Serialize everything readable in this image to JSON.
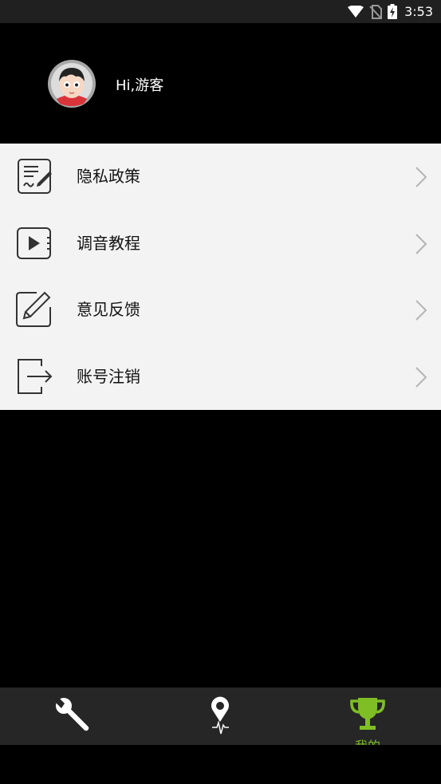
{
  "status_bar": {
    "time": "3:53"
  },
  "profile": {
    "greeting": "Hi,游客"
  },
  "menu": {
    "items": [
      {
        "label": "隐私政策",
        "icon": "privacy-document-icon"
      },
      {
        "label": "调音教程",
        "icon": "video-tutorial-icon"
      },
      {
        "label": "意见反馈",
        "icon": "edit-feedback-icon"
      },
      {
        "label": "账号注销",
        "icon": "logout-icon"
      }
    ]
  },
  "tabbar": {
    "tabs": [
      {
        "icon": "wrench-icon",
        "label": ""
      },
      {
        "icon": "tuner-pin-icon",
        "label": ""
      },
      {
        "icon": "trophy-icon",
        "label": "我的",
        "active": true
      }
    ],
    "active_color": "#7fbe25"
  }
}
